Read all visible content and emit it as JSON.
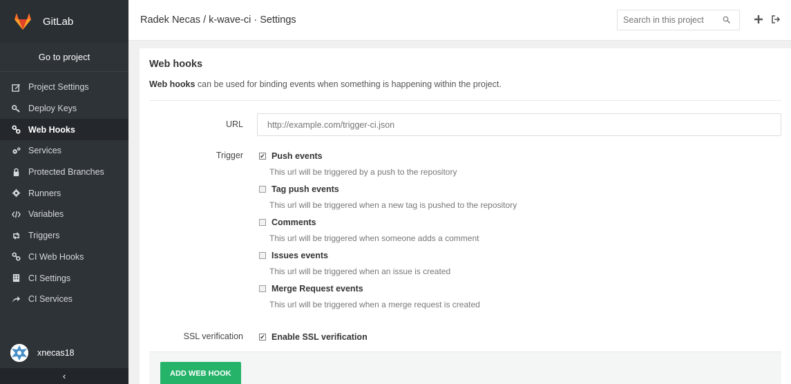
{
  "app": {
    "name": "GitLab"
  },
  "sidebar": {
    "goto_label": "Go to project",
    "items": [
      {
        "label": "Project Settings",
        "icon": "edit-icon"
      },
      {
        "label": "Deploy Keys",
        "icon": "key-icon"
      },
      {
        "label": "Web Hooks",
        "icon": "link-icon",
        "active": true
      },
      {
        "label": "Services",
        "icon": "cogs-icon"
      },
      {
        "label": "Protected Branches",
        "icon": "lock-icon"
      },
      {
        "label": "Runners",
        "icon": "gear-icon"
      },
      {
        "label": "Variables",
        "icon": "code-icon"
      },
      {
        "label": "Triggers",
        "icon": "retweet-icon"
      },
      {
        "label": "CI Web Hooks",
        "icon": "link-icon"
      },
      {
        "label": "CI Settings",
        "icon": "building-icon"
      },
      {
        "label": "CI Services",
        "icon": "share-icon"
      }
    ],
    "user": "xnecas18",
    "collapse_glyph": "‹"
  },
  "header": {
    "title": "Radek Necas / k-wave-ci · Settings",
    "search_placeholder": "Search in this project"
  },
  "main": {
    "heading": "Web hooks",
    "description_bold": "Web hooks",
    "description_rest": " can be used for binding events when something is happening within the project.",
    "url_label": "URL",
    "url_placeholder": "http://example.com/trigger-ci.json",
    "trigger_label": "Trigger",
    "triggers": [
      {
        "label": "Push events",
        "help": "This url will be triggered by a push to the repository",
        "checked": true
      },
      {
        "label": "Tag push events",
        "help": "This url will be triggered when a new tag is pushed to the repository",
        "checked": false
      },
      {
        "label": "Comments",
        "help": "This url will be triggered when someone adds a comment",
        "checked": false
      },
      {
        "label": "Issues events",
        "help": "This url will be triggered when an issue is created",
        "checked": false
      },
      {
        "label": "Merge Request events",
        "help": "This url will be triggered when a merge request is created",
        "checked": false
      }
    ],
    "ssl_label": "SSL verification",
    "ssl_option": {
      "label": "Enable SSL verification",
      "checked": true
    },
    "submit_label": "ADD WEB HOOK"
  },
  "colors": {
    "sidebar_bg": "#2e3338",
    "brand_orange": "#fc6d26",
    "success": "#25b36a"
  }
}
